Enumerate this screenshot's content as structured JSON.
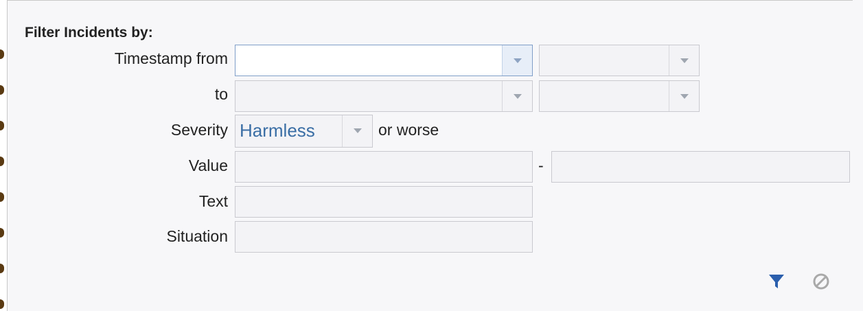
{
  "panel": {
    "title": "Filter Incidents by:"
  },
  "timestamp": {
    "from_label": "Timestamp from",
    "to_label": "to",
    "from_date": "",
    "from_time": "",
    "to_date": "",
    "to_time": ""
  },
  "severity": {
    "label": "Severity",
    "selected": "Harmless",
    "suffix": "or worse"
  },
  "value": {
    "label": "Value",
    "from": "",
    "separator": "-",
    "to": ""
  },
  "text": {
    "label": "Text",
    "value": ""
  },
  "situation": {
    "label": "Situation",
    "value": ""
  },
  "actions": {
    "apply_icon": "filter-icon",
    "clear_icon": "no-entry-icon"
  },
  "colors": {
    "accent": "#2b5fad",
    "link_text": "#3a6ea5",
    "disabled_icon": "#a9a9a9"
  }
}
